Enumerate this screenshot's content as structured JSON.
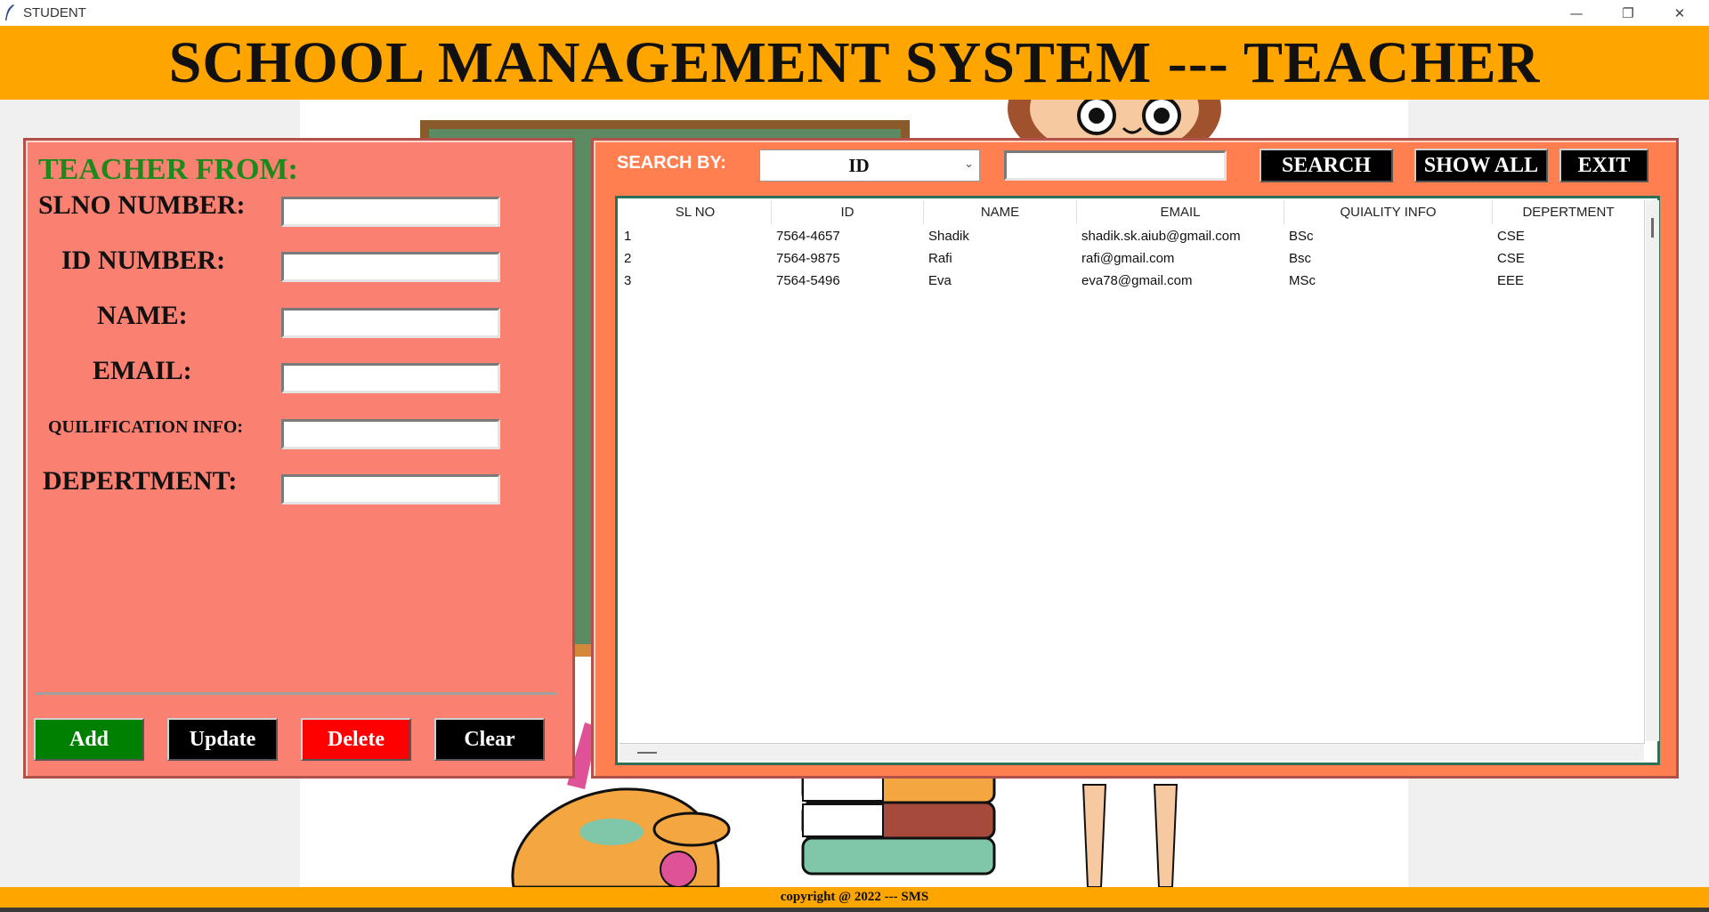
{
  "window": {
    "title": "STUDENT",
    "controls": {
      "minimize": "—",
      "restore": "❐",
      "close": "✕"
    }
  },
  "header": {
    "title": "SCHOOL MANAGEMENT SYSTEM --- TEACHER"
  },
  "form": {
    "title": "TEACHER FROM:",
    "fields": [
      {
        "label": "SLNO NUMBER:",
        "value": ""
      },
      {
        "label": "ID NUMBER:",
        "value": ""
      },
      {
        "label": "NAME:",
        "value": ""
      },
      {
        "label": "EMAIL:",
        "value": ""
      },
      {
        "label": "QUILIFICATION INFO:",
        "value": ""
      },
      {
        "label": "DEPERTMENT:",
        "value": ""
      }
    ],
    "buttons": {
      "add": "Add",
      "update": "Update",
      "delete": "Delete",
      "clear": "Clear"
    }
  },
  "search": {
    "label": "SEARCH BY:",
    "selected": "ID",
    "query": "",
    "buttons": {
      "search": "SEARCH",
      "show_all": "SHOW ALL",
      "exit": "EXIT"
    }
  },
  "table": {
    "columns": [
      "SL NO",
      "ID",
      "NAME",
      "EMAIL",
      "QUIALITY INFO",
      "DEPERTMENT"
    ],
    "rows": [
      [
        "1",
        "7564-4657",
        "Shadik",
        "shadik.sk.aiub@gmail.com",
        "BSc",
        "CSE"
      ],
      [
        "2",
        "7564-9875",
        "Rafi",
        "rafi@gmail.com",
        "Bsc",
        "CSE"
      ],
      [
        "3",
        "7564-5496",
        "Eva",
        "eva78@gmail.com",
        "MSc",
        "EEE"
      ]
    ]
  },
  "footer": {
    "text": "copyright @ 2022 --- SMS"
  },
  "colors": {
    "header_bg": "#ffa500",
    "form_panel_bg": "#fa8072",
    "list_panel_bg": "#ff7f50",
    "form_title": "#1b8a1b",
    "add_button": "#008000",
    "delete_button": "#ff0000",
    "dark_button": "#000000"
  }
}
